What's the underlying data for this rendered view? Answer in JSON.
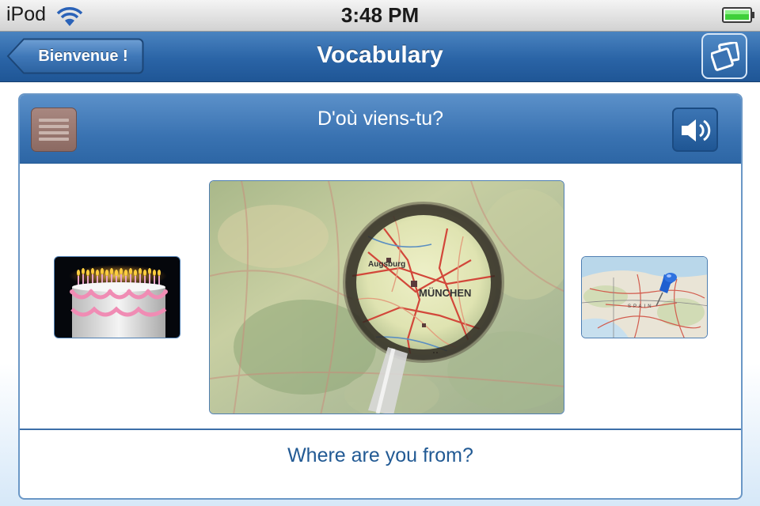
{
  "status_bar": {
    "carrier": "iPod",
    "time": "3:48 PM",
    "wifi_icon": "wifi-icon",
    "battery_icon": "battery-icon"
  },
  "nav_bar": {
    "back_label": "Bienvenue !",
    "title": "Vocabulary",
    "cards_icon": "flashcards-icon"
  },
  "card": {
    "question": "D'où viens-tu?",
    "answer": "Where are you from?",
    "menu_icon": "menu-icon",
    "sound_icon": "speaker-icon",
    "images": [
      "birthday-cake-image",
      "magnifier-map-image",
      "map-pin-image"
    ]
  },
  "colors": {
    "nav_blue": "#2a64a6",
    "card_header_blue": "#3a73b2",
    "answer_text": "#225a94",
    "menu_button": "#8c6a62",
    "battery_green": "#3fcf3a"
  }
}
